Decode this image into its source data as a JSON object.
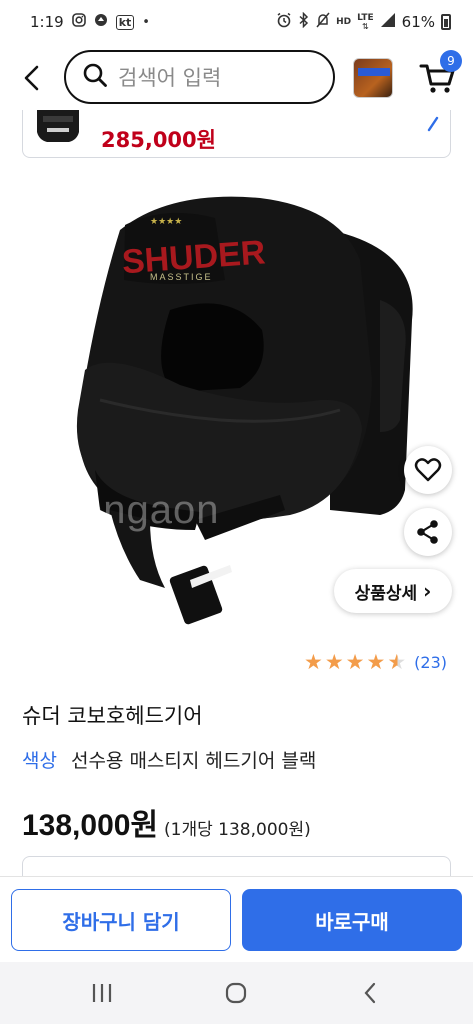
{
  "status": {
    "time": "1:19",
    "carrier": "kt",
    "dot": "•",
    "hd_label": "HD",
    "lte_label": "LTE",
    "battery_percent": "61%"
  },
  "header": {
    "search_placeholder": "검색어 입력",
    "cart_count": "9"
  },
  "recommended": {
    "price": "285,000원"
  },
  "image": {
    "brand_text": "SHUDER",
    "sub_text": "MASSTIGE",
    "watermark": "ongaon"
  },
  "detail_button": {
    "label": "상품상세",
    "chevron": "›"
  },
  "rating": {
    "value": 4.5,
    "count_label": "(23)"
  },
  "product": {
    "title": "슈더 코보호헤드기어",
    "option_key": "색상",
    "option_value": "선수용 매스티지 헤드기어 블랙",
    "price": "138,000원",
    "unit_price": "(1개당 138,000원)"
  },
  "actions": {
    "cart_label": "장바구니 담기",
    "buy_label": "바로구매"
  },
  "colors": {
    "accent": "#2f6ee8",
    "price_red": "#c0001a",
    "star": "#f39c4a"
  }
}
